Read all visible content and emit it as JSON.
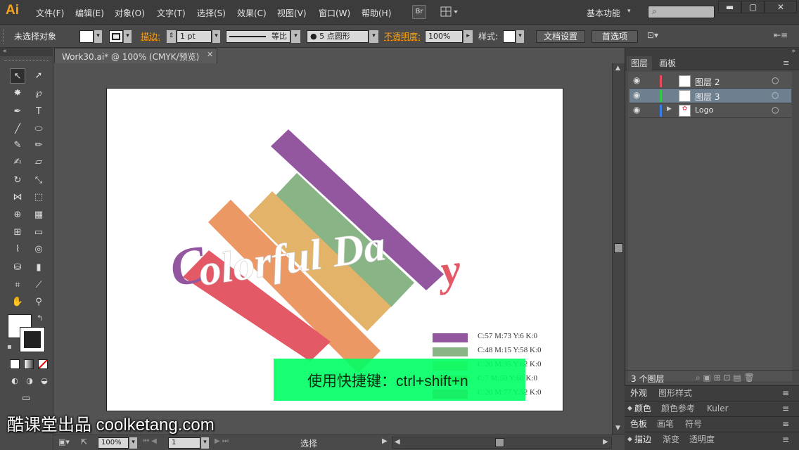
{
  "app": {
    "logo": "Ai"
  },
  "menu": [
    "文件(F)",
    "编辑(E)",
    "对象(O)",
    "文字(T)",
    "选择(S)",
    "效果(C)",
    "视图(V)",
    "窗口(W)",
    "帮助(H)"
  ],
  "menu_right": {
    "br_label": "Br",
    "workspace": "基本功能"
  },
  "control": {
    "selection": "未选择对象",
    "stroke_label": "描边:",
    "stroke_weight": "1 pt",
    "profile": "等比",
    "brush": "5 点圆形",
    "opacity_label": "不透明度:",
    "opacity_value": "100%",
    "style_label": "样式:",
    "doc_setup": "文档设置",
    "prefs": "首选项"
  },
  "document": {
    "tab_title": "Work30.ai* @ 100% (CMYK/预览)"
  },
  "artwork": {
    "title_text": "Colorful Day",
    "legend": [
      {
        "label": "C:57 M:73 Y:6 K:0",
        "color": "#93579f"
      },
      {
        "label": "C:48 M:15 Y:58 K:0",
        "color": "#88b486"
      },
      {
        "label": "C:20 M:35 Y:62 K:0",
        "color": "#e2b368"
      },
      {
        "label": "C:7 M:50 Y:60 K:0",
        "color": "#ec9865"
      },
      {
        "label": "C:20 M:77 Y:52 K:0",
        "color": "#e35966"
      }
    ]
  },
  "status": {
    "zoom": "100%",
    "page": "1",
    "tool": "选择"
  },
  "layers_panel": {
    "tabs": [
      "图层",
      "画板"
    ],
    "layers": [
      {
        "name": "图层 2",
        "color": "#e84a5a"
      },
      {
        "name": "图层 3",
        "color": "#2ec84a"
      },
      {
        "name": "Logo",
        "color": "#3a7ee8"
      }
    ],
    "count": "3 个图层"
  },
  "panels": {
    "appearance_tabs": [
      "外观",
      "图形样式"
    ],
    "color_tabs": [
      "颜色",
      "颜色参考",
      "Kuler"
    ],
    "swatch_tabs": [
      "色板",
      "画笔",
      "符号"
    ],
    "stroke_tabs": [
      "描边",
      "渐变",
      "透明度"
    ]
  },
  "overlay": {
    "shortcut": "使用快捷键：ctrl+shift+n",
    "watermark": "酷课堂出品 coolketang.com"
  },
  "colors": {
    "accent": "#f7a21b",
    "panel": "#4a4a4a",
    "overlay_green": "#00ff64"
  }
}
